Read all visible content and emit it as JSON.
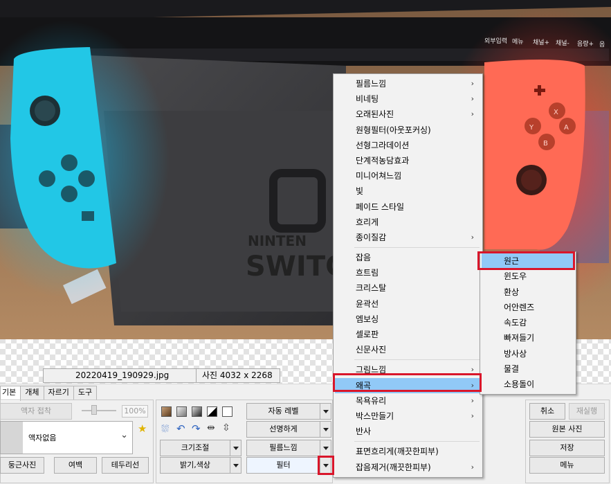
{
  "infobar": {
    "filename": "20220419_190929.jpg",
    "photo_size": "사진 4032 x 2268"
  },
  "tabs": [
    "기본",
    "개체",
    "자르기",
    "도구"
  ],
  "frame": {
    "frame_paste_label": "액자 접착",
    "zoom_value": "100%",
    "frame_select_value": "액자없음",
    "round_photo_label": "둥근사진",
    "margin_label": "여백",
    "border_label": "테두리선"
  },
  "tools": {
    "resize_label": "크기조절",
    "brightness_label": "밝기,색상",
    "auto_level_label": "자동 레벨",
    "sharpen_label": "선명하게",
    "film_label": "필름느낌",
    "filter_label": "필터"
  },
  "right_buttons": {
    "cancel": "취소",
    "redo": "재실행",
    "original": "원본 사진",
    "save": "저장",
    "menu": "메뉴"
  },
  "menu_items": [
    {
      "label": "필름느낌",
      "arrow": true
    },
    {
      "label": "비네팅",
      "arrow": true
    },
    {
      "label": "오래된사진",
      "arrow": true
    },
    {
      "label": "원형필터(아웃포커싱)",
      "arrow": false
    },
    {
      "label": "선형그라데이션",
      "arrow": false
    },
    {
      "label": "단계적농담효과",
      "arrow": false
    },
    {
      "label": "미니어쳐느낌",
      "arrow": false
    },
    {
      "label": "빛",
      "arrow": false
    },
    {
      "label": "페이드 스타일",
      "arrow": false
    },
    {
      "label": "흐리게",
      "arrow": false
    },
    {
      "label": "종이질감",
      "arrow": true
    },
    {
      "sep": true
    },
    {
      "label": "잡음",
      "arrow": false
    },
    {
      "label": "흐트림",
      "arrow": false
    },
    {
      "label": "크리스탈",
      "arrow": false
    },
    {
      "label": "윤곽선",
      "arrow": false
    },
    {
      "label": "엠보싱",
      "arrow": false
    },
    {
      "label": "셀로판",
      "arrow": false
    },
    {
      "label": "신문사진",
      "arrow": false
    },
    {
      "sep": true
    },
    {
      "label": "그림느낌",
      "arrow": true
    },
    {
      "label": "왜곡",
      "arrow": true,
      "selected": true
    },
    {
      "label": "목욕유리",
      "arrow": true
    },
    {
      "label": "박스만들기",
      "arrow": true
    },
    {
      "label": "반사",
      "arrow": false
    },
    {
      "sep": true
    },
    {
      "label": "표면흐리게(깨끗한피부)",
      "arrow": false
    },
    {
      "label": "잡음제거(깨끗한피부)",
      "arrow": true
    }
  ],
  "submenu_items": [
    {
      "label": "원근",
      "selected": true
    },
    {
      "label": "윈도우"
    },
    {
      "label": "환상"
    },
    {
      "label": "어안렌즈"
    },
    {
      "label": "속도감"
    },
    {
      "label": "빠져들기"
    },
    {
      "label": "방사상"
    },
    {
      "label": "물결"
    },
    {
      "label": "소용돌이"
    }
  ],
  "photo_text": {
    "tv_labels": [
      "외부입력",
      "메뉴",
      "채널+",
      "채널-",
      "음량+",
      "음"
    ],
    "brand_line1": "NINTEN",
    "brand_line2": "SWITC",
    "btn_x": "X",
    "btn_y": "Y",
    "btn_a": "A",
    "btn_b": "B"
  },
  "colors": {
    "menu_highlight": "#91c9f7",
    "callout_red": "#d9162b",
    "joycon_left": "#22c7e6",
    "joycon_right": "#ff6a55"
  }
}
